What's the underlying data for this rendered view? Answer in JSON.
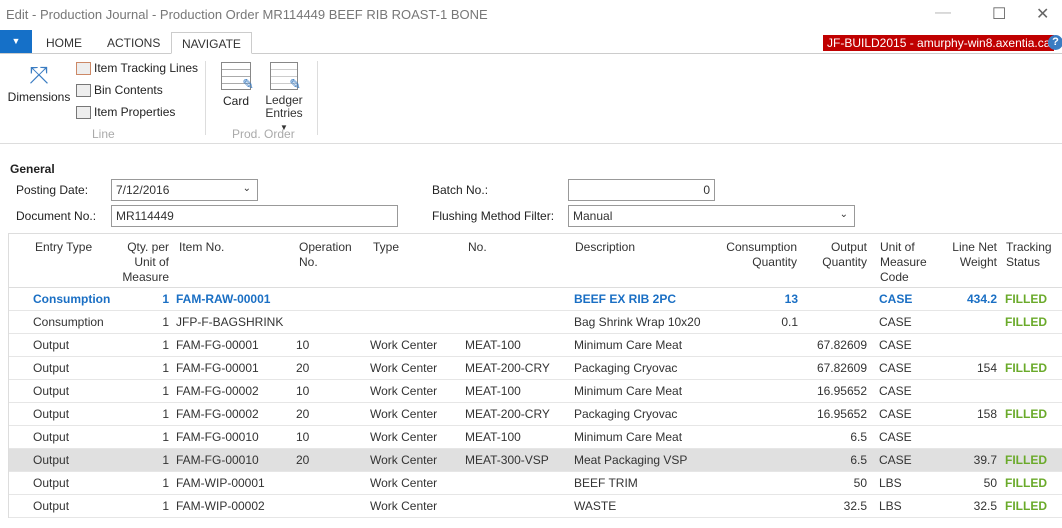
{
  "window": {
    "title": "Edit - Production Journal - Production Order MR114449 BEEF RIB ROAST-1 BONE"
  },
  "ribbon": {
    "tabs": [
      "HOME",
      "ACTIONS",
      "NAVIGATE"
    ],
    "active_tab": "NAVIGATE",
    "line_group": {
      "label": "Line",
      "dimensions": "Dimensions",
      "item_tracking": "Item Tracking Lines",
      "bin_contents": "Bin Contents",
      "item_properties": "Item Properties"
    },
    "prod_group": {
      "label": "Prod. Order",
      "card": "Card",
      "ledger1": "Ledger",
      "ledger2": "Entries"
    }
  },
  "server": "JF-BUILD2015 - amurphy-win8.axentia.ca",
  "general": {
    "heading": "General",
    "posting_date_label": "Posting Date:",
    "posting_date": "7/12/2016",
    "document_no_label": "Document No.:",
    "document_no": "MR114449",
    "batch_no_label": "Batch No.:",
    "batch_no": "0",
    "flushing_label": "Flushing Method Filter:",
    "flushing": "Manual"
  },
  "columns": {
    "entry_type": "Entry Type",
    "qty_per": "Qty. per Unit of Measure",
    "item_no": "Item No.",
    "operation_no": "Operation No.",
    "type": "Type",
    "no": "No.",
    "description": "Description",
    "consumption_qty": "Consumption Quantity",
    "output_qty": "Output Quantity",
    "uom": "Unit of Measure Code",
    "net_weight": "Line Net Weight",
    "tracking": "Tracking Status"
  },
  "rows": [
    {
      "entry_type": "Consumption",
      "qty_per": "1",
      "item_no": "FAM-RAW-00001",
      "operation_no": "",
      "type": "",
      "no": "",
      "description": "BEEF EX RIB 2PC",
      "consumption_qty": "13",
      "output_qty": "",
      "uom": "CASE",
      "net_weight": "434.2",
      "tracking": "FILLED"
    },
    {
      "entry_type": "Consumption",
      "qty_per": "1",
      "item_no": "JFP-F-BAGSHRINK",
      "operation_no": "",
      "type": "",
      "no": "",
      "description": "Bag Shrink Wrap 10x20",
      "consumption_qty": "0.1",
      "output_qty": "",
      "uom": "CASE",
      "net_weight": "",
      "tracking": "FILLED"
    },
    {
      "entry_type": "Output",
      "qty_per": "1",
      "item_no": "FAM-FG-00001",
      "operation_no": "10",
      "type": "Work Center",
      "no": "MEAT-100",
      "description": "Minimum Care Meat",
      "consumption_qty": "",
      "output_qty": "67.82609",
      "uom": "CASE",
      "net_weight": "",
      "tracking": ""
    },
    {
      "entry_type": "Output",
      "qty_per": "1",
      "item_no": "FAM-FG-00001",
      "operation_no": "20",
      "type": "Work Center",
      "no": "MEAT-200-CRY",
      "description": "Packaging Cryovac",
      "consumption_qty": "",
      "output_qty": "67.82609",
      "uom": "CASE",
      "net_weight": "154",
      "tracking": "FILLED"
    },
    {
      "entry_type": "Output",
      "qty_per": "1",
      "item_no": "FAM-FG-00002",
      "operation_no": "10",
      "type": "Work Center",
      "no": "MEAT-100",
      "description": "Minimum Care Meat",
      "consumption_qty": "",
      "output_qty": "16.95652",
      "uom": "CASE",
      "net_weight": "",
      "tracking": ""
    },
    {
      "entry_type": "Output",
      "qty_per": "1",
      "item_no": "FAM-FG-00002",
      "operation_no": "20",
      "type": "Work Center",
      "no": "MEAT-200-CRY",
      "description": "Packaging Cryovac",
      "consumption_qty": "",
      "output_qty": "16.95652",
      "uom": "CASE",
      "net_weight": "158",
      "tracking": "FILLED"
    },
    {
      "entry_type": "Output",
      "qty_per": "1",
      "item_no": "FAM-FG-00010",
      "operation_no": "10",
      "type": "Work Center",
      "no": "MEAT-100",
      "description": "Minimum Care Meat",
      "consumption_qty": "",
      "output_qty": "6.5",
      "uom": "CASE",
      "net_weight": "",
      "tracking": ""
    },
    {
      "entry_type": "Output",
      "qty_per": "1",
      "item_no": "FAM-FG-00010",
      "operation_no": "20",
      "type": "Work Center",
      "no": "MEAT-300-VSP",
      "description": "Meat Packaging VSP",
      "consumption_qty": "",
      "output_qty": "6.5",
      "uom": "CASE",
      "net_weight": "39.7",
      "tracking": "FILLED"
    },
    {
      "entry_type": "Output",
      "qty_per": "1",
      "item_no": "FAM-WIP-00001",
      "operation_no": "",
      "type": "Work Center",
      "no": "",
      "description": "BEEF TRIM",
      "consumption_qty": "",
      "output_qty": "50",
      "uom": "LBS",
      "net_weight": "50",
      "tracking": "FILLED"
    },
    {
      "entry_type": "Output",
      "qty_per": "1",
      "item_no": "FAM-WIP-00002",
      "operation_no": "",
      "type": "Work Center",
      "no": "",
      "description": "WASTE",
      "consumption_qty": "",
      "output_qty": "32.5",
      "uom": "LBS",
      "net_weight": "32.5",
      "tracking": "FILLED"
    }
  ]
}
